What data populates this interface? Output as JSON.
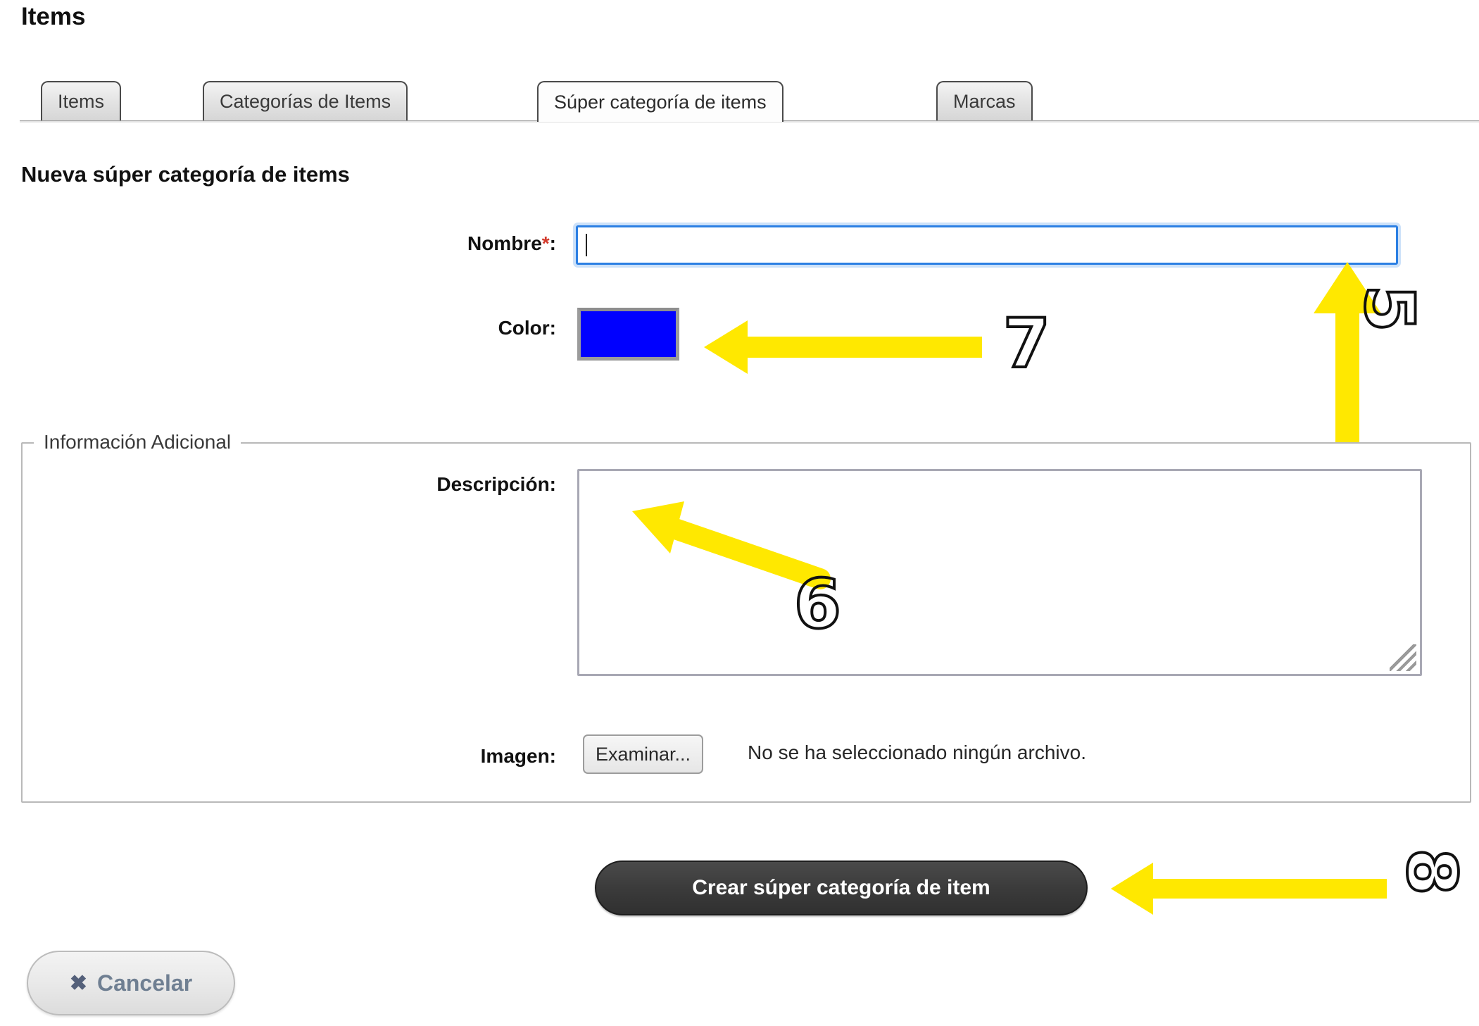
{
  "page": {
    "title": "Items"
  },
  "tabs": [
    {
      "label": "Items",
      "active": false
    },
    {
      "label": "Categorías de Items",
      "active": false
    },
    {
      "label": "Súper categoría de items",
      "active": true
    },
    {
      "label": "Marcas",
      "active": false
    }
  ],
  "form": {
    "heading": "Nueva súper categoría de items",
    "nombre": {
      "label": "Nombre",
      "required_marker": "*",
      "colon": ":",
      "value": "",
      "placeholder": ""
    },
    "color": {
      "label": "Color:",
      "value": "#0000FF"
    },
    "fieldset": {
      "legend": "Información Adicional",
      "descripcion": {
        "label": "Descripción:",
        "value": "",
        "placeholder": ""
      },
      "imagen": {
        "label": "Imagen:",
        "browse_button": "Examinar...",
        "status": "No se ha seleccionado ningún archivo."
      }
    },
    "submit_label": "Crear súper categoría de item",
    "cancel_label": "Cancelar",
    "cancel_icon": "✖"
  },
  "annotations": {
    "arrow_color": "#FFE800",
    "markers": [
      {
        "id": "5",
        "label": "5",
        "points_to": "nombre-input"
      },
      {
        "id": "6",
        "label": "6",
        "points_to": "descripcion-textarea"
      },
      {
        "id": "7",
        "label": "7",
        "points_to": "color-swatch"
      },
      {
        "id": "8",
        "label": "8",
        "points_to": "submit-button"
      }
    ]
  }
}
